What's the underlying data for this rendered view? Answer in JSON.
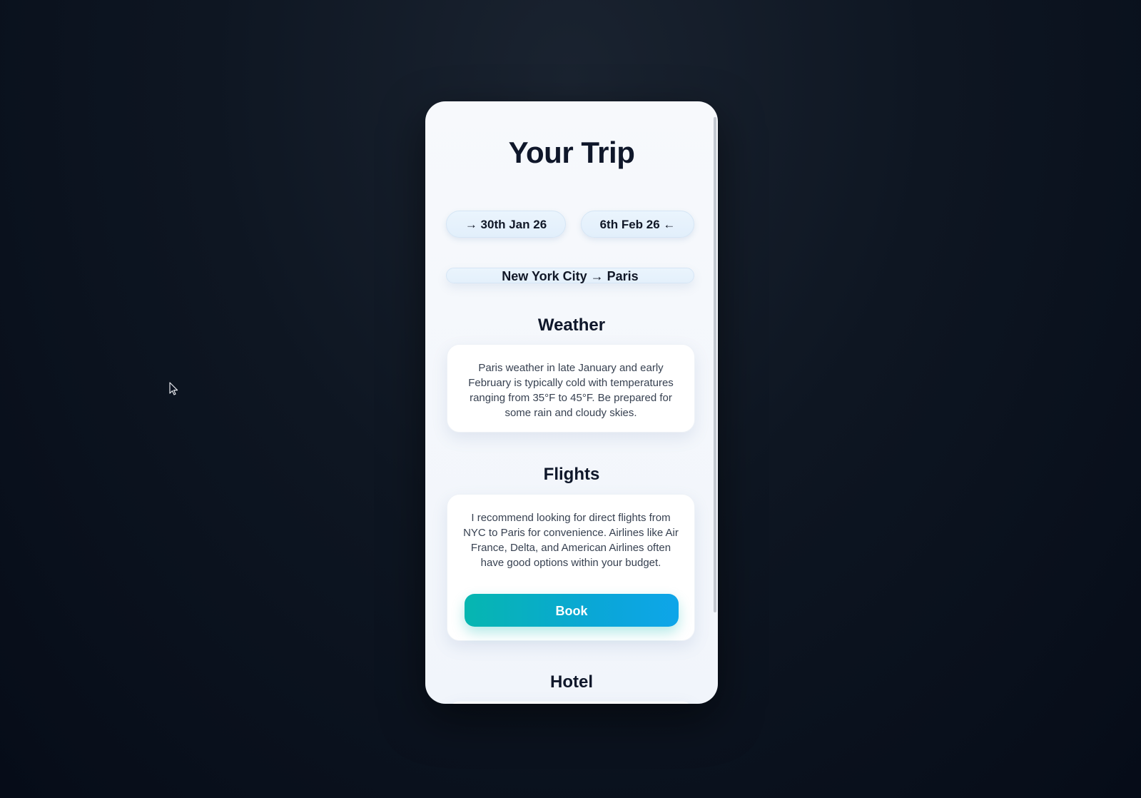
{
  "trip": {
    "title": "Your Trip",
    "depart_date": "→ 30th Jan 26",
    "return_date": "6th Feb 26 ←",
    "route": "New York City → Paris"
  },
  "weather": {
    "heading": "Weather",
    "text": "Paris weather in late January and early February is typically cold with temperatures ranging from 35°F to 45°F. Be prepared for some rain and cloudy skies."
  },
  "flights": {
    "heading": "Flights",
    "text": "I recommend looking for direct flights from NYC to Paris for convenience. Airlines like Air France, Delta, and American Airlines often have good options within your budget.",
    "book_label": "Book"
  },
  "hotel": {
    "heading": "Hotel"
  },
  "colors": {
    "background": "#0e1622",
    "card": "#f7f9fc",
    "accent_start": "#06b6b0",
    "accent_end": "#0ea5e9",
    "heading_text": "#0f172a",
    "body_text": "#374151"
  },
  "icons": {
    "cursor": "mouse-pointer-icon"
  }
}
